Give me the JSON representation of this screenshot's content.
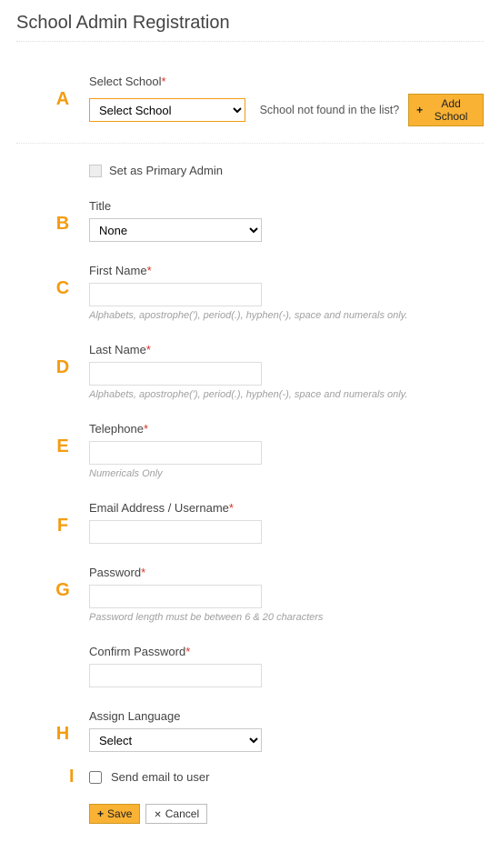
{
  "page_title": "School Admin Registration",
  "letters": {
    "A": "A",
    "B": "B",
    "C": "C",
    "D": "D",
    "E": "E",
    "F": "F",
    "G": "G",
    "H": "H",
    "I": "I"
  },
  "school": {
    "label": "Select School",
    "placeholder_option": "Select School",
    "not_found": "School not found in the list?",
    "add_button": "Add School"
  },
  "primary_admin": {
    "label": "Set as Primary Admin"
  },
  "title": {
    "label": "Title",
    "value": "None"
  },
  "first_name": {
    "label": "First Name",
    "value": "",
    "hint": "Alphabets, apostrophe('), period(.), hyphen(-), space and numerals only."
  },
  "last_name": {
    "label": "Last Name",
    "value": "",
    "hint": "Alphabets, apostrophe('), period(.), hyphen(-), space and numerals only."
  },
  "telephone": {
    "label": "Telephone",
    "value": "",
    "hint": "Numericals Only"
  },
  "email": {
    "label": "Email Address / Username",
    "value": ""
  },
  "password": {
    "label": "Password",
    "value": "",
    "hint": "Password length must be between 6 & 20 characters"
  },
  "confirm": {
    "label": "Confirm Password",
    "value": ""
  },
  "language": {
    "label": "Assign Language",
    "value": "Select"
  },
  "send_email": {
    "label": "Send email to user"
  },
  "buttons": {
    "save": "Save",
    "cancel": "Cancel"
  }
}
